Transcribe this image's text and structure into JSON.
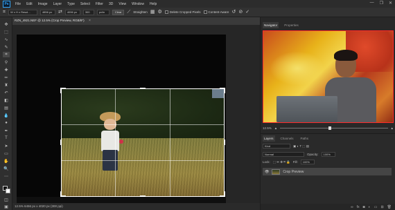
{
  "app": {
    "logo": "Ps"
  },
  "menu": [
    "File",
    "Edit",
    "Image",
    "Layer",
    "Type",
    "Select",
    "Filter",
    "3D",
    "View",
    "Window",
    "Help"
  ],
  "window_controls": [
    "—",
    "❐",
    "✕"
  ],
  "options_bar": {
    "ratio": "W x H x Resol...",
    "width": "4856 px",
    "height": "4096 px",
    "resolution": "300",
    "units": "px/in",
    "clear_label": "Clear",
    "straighten_label": "Straighten",
    "delete_cropped_label": "Delete Cropped Pixels",
    "content_aware_label": "Content-Aware"
  },
  "document": {
    "tab_label": "RZN_4921.NEF @ 12.5% (Crop Preview, RGB/8*)",
    "status_text": "12.5%   6456 px x 4020 px (300 ppi)"
  },
  "navigator": {
    "tabs": [
      "Navigator",
      "Properties"
    ],
    "zoom": "12.5%"
  },
  "layers": {
    "tabs": [
      "Layers",
      "Channels",
      "Paths"
    ],
    "search_placeholder": "Kind",
    "blend_mode": "Normal",
    "opacity_label": "Opacity:",
    "opacity": "100%",
    "lock_label": "Lock:",
    "fill_label": "Fill:",
    "fill": "100%",
    "layer_name": "Crop Preview"
  }
}
